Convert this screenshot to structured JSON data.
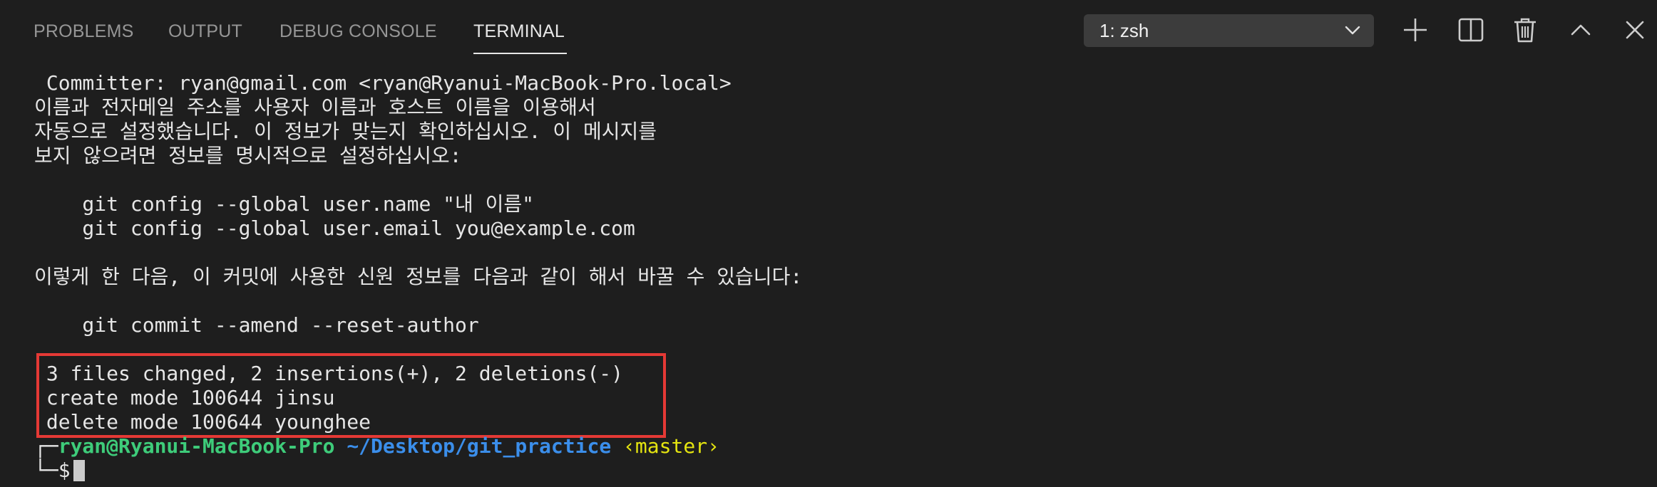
{
  "tabs": [
    {
      "label": "PROBLEMS"
    },
    {
      "label": "OUTPUT"
    },
    {
      "label": "DEBUG CONSOLE"
    },
    {
      "label": "TERMINAL"
    }
  ],
  "active_tab": "TERMINAL",
  "terminal_select": {
    "value": "1: zsh"
  },
  "toolbar": {
    "icons": [
      "plus-icon",
      "split-icon",
      "trash-icon",
      "chevron-up-icon",
      "close-icon"
    ]
  },
  "terminal": {
    "lines": [
      " Committer: ryan@gmail.com <ryan@Ryanui-MacBook-Pro.local>",
      "이름과 전자메일 주소를 사용자 이름과 호스트 이름을 이용해서",
      "자동으로 설정했습니다. 이 정보가 맞는지 확인하십시오. 이 메시지를",
      "보지 않으려면 정보를 명시적으로 설정하십시오:",
      "",
      "    git config --global user.name \"내 이름\"",
      "    git config --global user.email you@example.com",
      "",
      "이렇게 한 다음, 이 커밋에 사용한 신원 정보를 다음과 같이 해서 바꿀 수 있습니다:",
      "",
      "    git commit --amend --reset-author",
      "",
      " 3 files changed, 2 insertions(+), 2 deletions(-)",
      " create mode 100644 jinsu",
      " delete mode 100644 younghee"
    ],
    "prompt": {
      "top_bracket": "┌─",
      "user_host": "ryan@Ryanui-MacBook-Pro",
      "path": "~/Desktop/git_practice",
      "branch": "‹master›",
      "bottom_bracket": "└─",
      "symbol": "$"
    },
    "colors": {
      "user": "#3ecc7a",
      "path": "#3b8eea",
      "branch": "#e5e510",
      "highlight": "#e53935"
    }
  }
}
